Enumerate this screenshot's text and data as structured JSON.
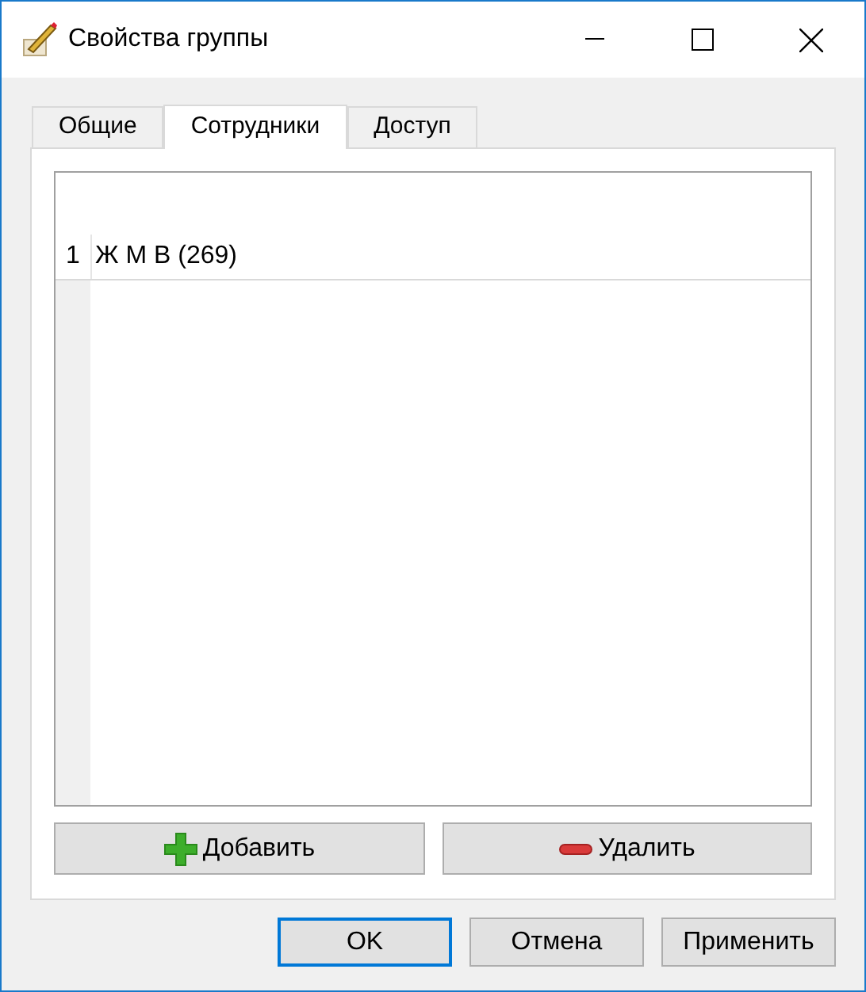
{
  "window": {
    "title": "Свойства группы"
  },
  "tabs": [
    {
      "label": "Общие",
      "selected": false
    },
    {
      "label": "Сотрудники",
      "selected": true
    },
    {
      "label": "Доступ",
      "selected": false
    }
  ],
  "list": {
    "rows": [
      {
        "number": "1",
        "name": "Ж М В (269)"
      }
    ]
  },
  "list_buttons": [
    {
      "kind": "add",
      "label": "Добавить"
    },
    {
      "kind": "remove",
      "label": "Удалить"
    }
  ],
  "dialog_buttons": [
    {
      "label": "OK",
      "focused": true
    },
    {
      "label": "Отмена",
      "focused": false
    },
    {
      "label": "Применить",
      "focused": false
    }
  ]
}
